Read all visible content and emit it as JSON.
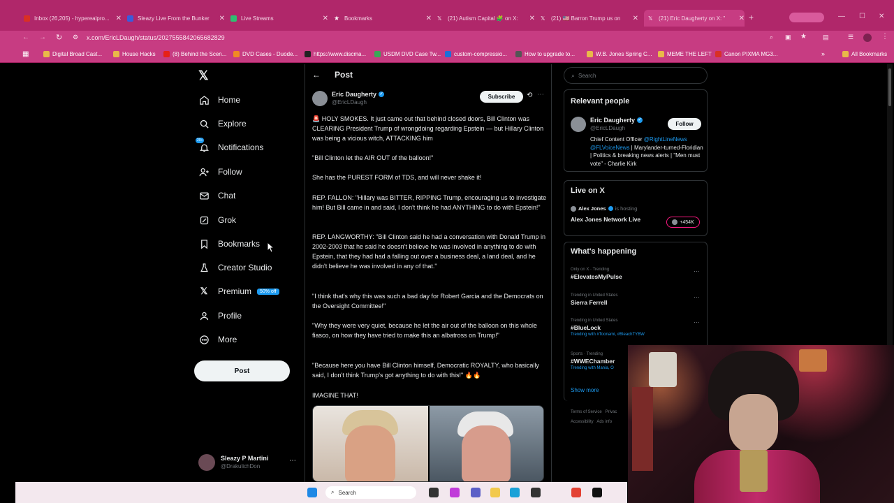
{
  "browser": {
    "tabs": [
      {
        "label": "Inbox (26,205) - hyperealpro...",
        "color": "#d93025"
      },
      {
        "label": "Sleazy Live From the Bunker",
        "color": "#3b5bdb"
      },
      {
        "label": "Live Streams",
        "color": "#2fbf71"
      },
      {
        "label": "Bookmarks",
        "color": "#ffffff"
      },
      {
        "label": "(21) Autism Capital 🧩 on X:",
        "color": "#ffffff"
      },
      {
        "label": "(21) 🇺🇸 Barron Trump us on",
        "color": "#ffffff"
      },
      {
        "label": "(21) Eric Daugherty on X: \"",
        "color": "#ffffff"
      }
    ],
    "url": "x.com/EricLDaugh/status/2027555842065682829",
    "bookmarks": [
      "Digital Broad Cast...",
      "House Hacks",
      "(8) Behind the Scen...",
      "DVD Cases - Duode...",
      "https://www.discma...",
      "USDM DVD Case Tw...",
      "custom-compressio...",
      "How to upgrade to...",
      "W.B. Jones Spring C...",
      "MEME THE LEFT",
      "Canon PIXMA MG3..."
    ],
    "all_bookmarks": "All Bookmarks"
  },
  "sidebar": {
    "nav": [
      {
        "label": "Home",
        "icon": "home-icon"
      },
      {
        "label": "Explore",
        "icon": "search-icon"
      },
      {
        "label": "Notifications",
        "icon": "bell-icon",
        "badge": "20+"
      },
      {
        "label": "Follow",
        "icon": "add-user-icon"
      },
      {
        "label": "Chat",
        "icon": "mail-icon"
      },
      {
        "label": "Grok",
        "icon": "grok-icon"
      },
      {
        "label": "Bookmarks",
        "icon": "bookmark-icon"
      },
      {
        "label": "Creator Studio",
        "icon": "flask-icon"
      },
      {
        "label": "Premium",
        "icon": "x-logo-icon",
        "badge": "50% off"
      },
      {
        "label": "Profile",
        "icon": "person-icon"
      },
      {
        "label": "More",
        "icon": "more-circle-icon"
      }
    ],
    "post_label": "Post",
    "account": {
      "name": "Sleazy P Martini",
      "handle": "@DrakulichDon"
    }
  },
  "post": {
    "header": "Post",
    "author_name": "Eric Daugherty",
    "author_handle": "@EricLDaugh",
    "subscribe_label": "Subscribe",
    "paragraphs": [
      "🚨 HOLY SMOKES. It just came out that behind closed doors, Bill Clinton was CLEARING President Trump of wrongdoing regarding Epstein — but Hillary Clinton was being a vicious witch, ATTACKING him",
      "\"Bill Clinton let the AIR OUT of the balloon!\"",
      "She has the PUREST FORM of TDS, and will never shake it!",
      "REP. FALLON: \"Hillary was BITTER, RIPPING Trump, encouraging us to investigate him! But Bill came in and said, I don't think he had ANYTHING to do with Epstein!\"",
      "REP. LANGWORTHY: \"Bill Clinton said he had a conversation with Donald Trump in 2002-2003 that he said he doesn't believe he was involved in anything to do with Epstein, that they had had a falling out over a business deal, a land deal, and he didn't believe he was involved in any of that.\"",
      "\"I think that's why this was such a bad day for Robert Garcia and the Democrats on the Oversight Committee!\"",
      "\"Why they were very quiet, because he let the air out of the balloon on this whole fiasco, on how they have tried to make this an albatross on Trump!\"",
      "\"Because here you have Bill Clinton himself, Democratic ROYALTY, who basically said, I don't think Trump's got anything to do with this!\" 🔥🔥",
      "IMAGINE THAT!"
    ]
  },
  "right": {
    "search_placeholder": "Search",
    "relevant_title": "Relevant people",
    "person": {
      "name": "Eric Daugherty",
      "handle": "@EricLDaugh",
      "follow_label": "Follow",
      "bio_prefix": "Chief Content Officer ",
      "bio_link1": "@RightLineNews",
      "bio_link2": "@FLVoiceNews",
      "bio_rest": " | Marylander-turned-Floridian | Politics & breaking news alerts | \"Men must vote\" - Charlie Kirk"
    },
    "live_title": "Live on X",
    "live": {
      "host": "Alex Jones",
      "hosting": "is hosting",
      "title": "Alex Jones Network Live",
      "count": "+454K"
    },
    "happening_title": "What's happening",
    "trends": [
      {
        "meta": "Only on X · Trending",
        "name": "#ElevatesMyPulse",
        "with": ""
      },
      {
        "meta": "Trending in United States",
        "name": "Sierra Ferrell",
        "with": ""
      },
      {
        "meta": "Trending in United States",
        "name": "#BlueLock",
        "with": "Trending with #Toonami, #BleachTYBW"
      },
      {
        "meta": "Sports · Trending",
        "name": "#WWEChamber",
        "with": "Trending with Mania, O"
      }
    ],
    "show_more": "Show more",
    "footer1": "Terms of Service   Privac",
    "footer2": "Accessibility   Ads info"
  },
  "taskbar": {
    "search_label": "Search"
  },
  "colors": {
    "browser_accent": "#c73c82",
    "x_blue": "#1d9bf0",
    "bg": "#000000"
  }
}
